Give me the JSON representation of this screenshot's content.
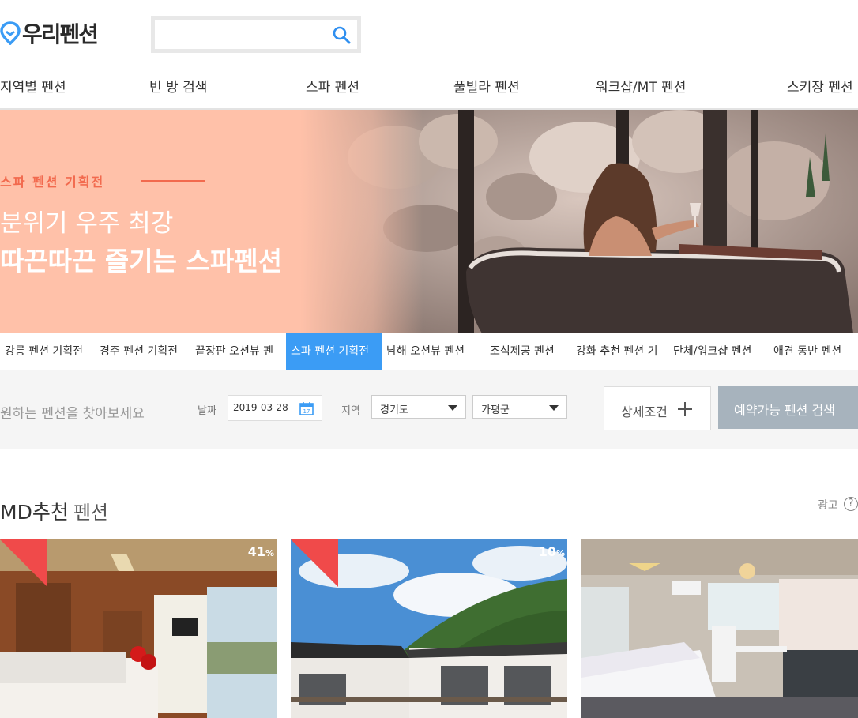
{
  "header": {
    "logo_text": "우리펜션",
    "search": {
      "value": "",
      "placeholder": ""
    }
  },
  "nav": {
    "items": [
      "지역별 펜션",
      "빈 방 검색",
      "스파 펜션",
      "풀빌라 펜션",
      "워크샵/MT 펜션",
      "스키장 펜션"
    ]
  },
  "banner": {
    "kicker": "스파 펜션 기획전",
    "subtitle": "분위기 우주 최강",
    "title": "따끈따끈 즐기는 스파펜션",
    "bg_color": "#ffc1a9",
    "accent_color": "#f26a4e"
  },
  "tabs": {
    "items": [
      "강릉 펜션 기획전",
      "경주 펜션 기획전",
      "끝장판 오션뷰 펜",
      "스파 펜션 기획전",
      "남해 오션뷰 펜션",
      "조식제공 펜션",
      "강화 추천 펜션 기",
      "단체/워크샵 펜션",
      "애견 동반 펜션"
    ],
    "active_index": 3,
    "active_color": "#3b9cf5"
  },
  "search_panel": {
    "prompt": "원하는 펜션을 찾아보세요",
    "date_label": "날짜",
    "date_value": "2019-03-28",
    "region_label": "지역",
    "region1": "경기도",
    "region2": "가평군",
    "detail_label": "상세조건",
    "submit_label": "예약가능 펜션 검색"
  },
  "md_section": {
    "title_strong": "MD추천",
    "title_light": "펜션",
    "ad_label": "광고",
    "help_icon": "?",
    "cards": [
      {
        "discount": "41",
        "unit": "%"
      },
      {
        "discount": "10",
        "unit": "%"
      },
      {
        "discount": "",
        "unit": ""
      }
    ]
  }
}
